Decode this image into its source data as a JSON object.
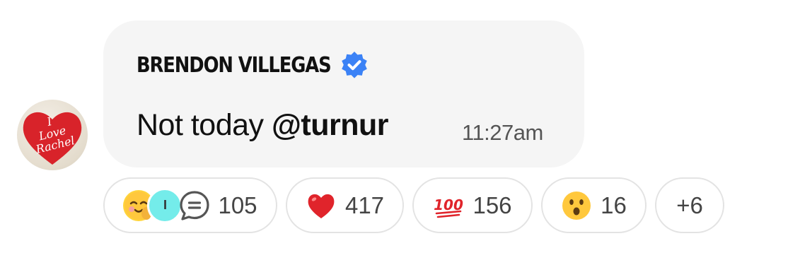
{
  "message": {
    "sender_name": "BRENDON VILLEGAS",
    "verified_icon": "verified-badge-icon",
    "text_prefix": "Not today ",
    "mention": "@turnur",
    "time": "11:27am"
  },
  "avatar": {
    "icon": "i-love-rachel-heart-avatar",
    "text_line1": "I",
    "text_line2": "Love",
    "text_line3": "Rachel",
    "color": "#d8232a"
  },
  "reactions": {
    "thread": {
      "avatar_letter": "I",
      "icon": "chat-bubble-icon",
      "count": "105"
    },
    "heart": {
      "icon": "red-heart-emoji",
      "count": "417"
    },
    "hundred": {
      "icon": "hundred-points-emoji",
      "label": "100",
      "count": "156"
    },
    "wow": {
      "icon": "surprised-face-emoji",
      "count": "16"
    },
    "more": {
      "label": "+6"
    }
  },
  "colors": {
    "bubble": "#f5f5f5",
    "verified": "#3b82f6",
    "pill_border": "#e3e3e3",
    "mini_avatar": "#74ecea"
  }
}
